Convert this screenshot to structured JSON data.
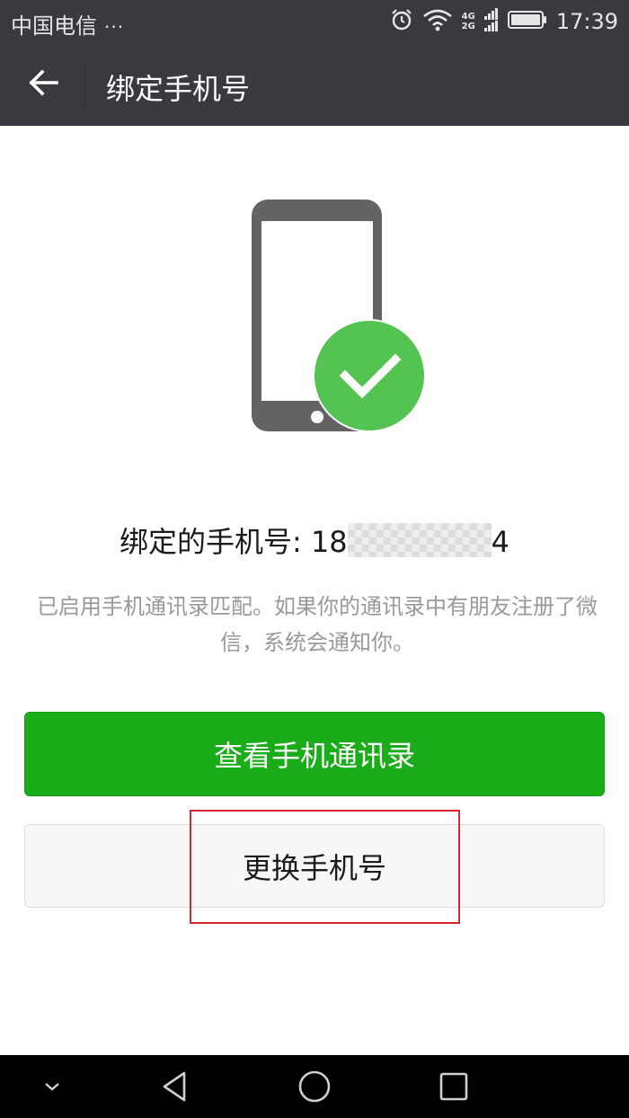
{
  "status_bar": {
    "carrier": "中国电信",
    "more": "···",
    "network_top": "4G",
    "network_bottom": "2G",
    "time": "17:39"
  },
  "header": {
    "title": "绑定手机号",
    "back_icon": "arrow-left-icon"
  },
  "illustration": {
    "phone_icon": "smartphone-icon",
    "check_icon": "checkmark-circle-icon",
    "check_color": "#53c452"
  },
  "bound_phone": {
    "label": "绑定的手机号:",
    "prefix": "18",
    "suffix": "4"
  },
  "description": "已启用手机通讯录匹配。如果你的通讯录中有朋友注册了微信，系统会通知你。",
  "buttons": {
    "view_contacts": "查看手机通讯录",
    "change_number": "更换手机号"
  },
  "colors": {
    "header_bg": "#393a3f",
    "primary_green": "#1aad19",
    "highlight_red": "#d9262c"
  },
  "nav_bar": {
    "icons": [
      "chevron-down-icon",
      "back-triangle-icon",
      "home-circle-icon",
      "recents-square-icon"
    ]
  }
}
